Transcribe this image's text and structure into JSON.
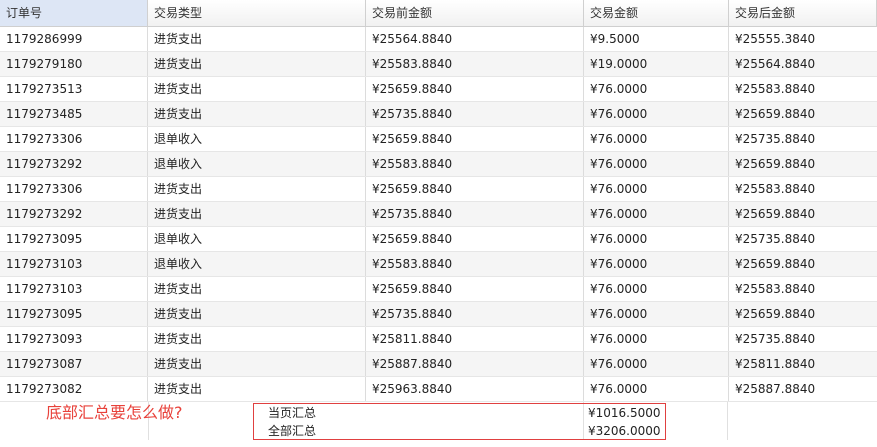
{
  "columns": [
    "订单号",
    "交易类型",
    "交易前金额",
    "交易金额",
    "交易后金额"
  ],
  "rows": [
    [
      "1179286999",
      "进货支出",
      "¥25564.8840",
      "¥9.5000",
      "¥25555.3840"
    ],
    [
      "1179279180",
      "进货支出",
      "¥25583.8840",
      "¥19.0000",
      "¥25564.8840"
    ],
    [
      "1179273513",
      "进货支出",
      "¥25659.8840",
      "¥76.0000",
      "¥25583.8840"
    ],
    [
      "1179273485",
      "进货支出",
      "¥25735.8840",
      "¥76.0000",
      "¥25659.8840"
    ],
    [
      "1179273306",
      "退单收入",
      "¥25659.8840",
      "¥76.0000",
      "¥25735.8840"
    ],
    [
      "1179273292",
      "退单收入",
      "¥25583.8840",
      "¥76.0000",
      "¥25659.8840"
    ],
    [
      "1179273306",
      "进货支出",
      "¥25659.8840",
      "¥76.0000",
      "¥25583.8840"
    ],
    [
      "1179273292",
      "进货支出",
      "¥25735.8840",
      "¥76.0000",
      "¥25659.8840"
    ],
    [
      "1179273095",
      "退单收入",
      "¥25659.8840",
      "¥76.0000",
      "¥25735.8840"
    ],
    [
      "1179273103",
      "退单收入",
      "¥25583.8840",
      "¥76.0000",
      "¥25659.8840"
    ],
    [
      "1179273103",
      "进货支出",
      "¥25659.8840",
      "¥76.0000",
      "¥25583.8840"
    ],
    [
      "1179273095",
      "进货支出",
      "¥25735.8840",
      "¥76.0000",
      "¥25659.8840"
    ],
    [
      "1179273093",
      "进货支出",
      "¥25811.8840",
      "¥76.0000",
      "¥25735.8840"
    ],
    [
      "1179273087",
      "进货支出",
      "¥25887.8840",
      "¥76.0000",
      "¥25811.8840"
    ],
    [
      "1179273082",
      "进货支出",
      "¥25963.8840",
      "¥76.0000",
      "¥25887.8840"
    ]
  ],
  "footer": {
    "question": "底部汇总要怎么做?",
    "page_total_label": "当页汇总",
    "page_total_value": "¥1016.5000",
    "all_total_label": "全部汇总",
    "all_total_value": "¥3206.0000"
  },
  "colors": {
    "annotation_red": "#e8413a",
    "alt_row": "#f5f5f5",
    "header_selected": "#dde6f5"
  }
}
